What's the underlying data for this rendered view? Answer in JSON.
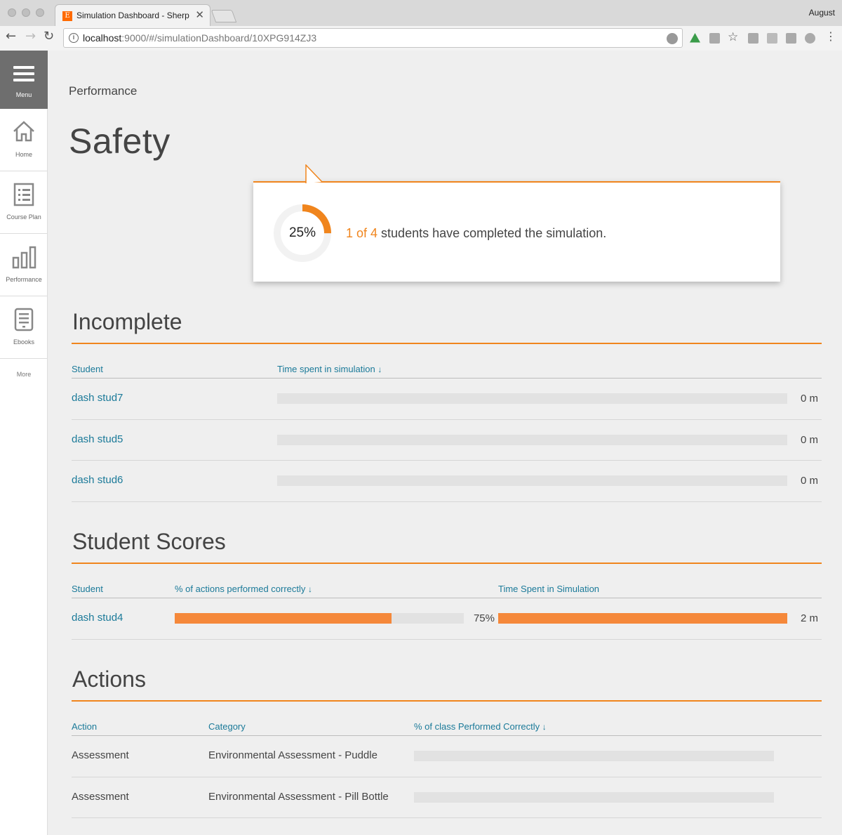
{
  "browser": {
    "tab_title": "Simulation Dashboard - Sherp",
    "tab_close": "✕",
    "profile_name": "August",
    "url_host": "localhost",
    "url_rest": ":9000/#/simulationDashboard/10XPG914ZJ3",
    "favicon_letter": "E"
  },
  "nav": {
    "menu_label": "Menu",
    "items": [
      {
        "label": "Home",
        "icon": "home-icon"
      },
      {
        "label": "Course Plan",
        "icon": "course-plan-icon"
      },
      {
        "label": "Performance",
        "icon": "bar-chart-icon"
      },
      {
        "label": "Ebooks",
        "icon": "ebook-icon"
      }
    ],
    "more_label": "More"
  },
  "page": {
    "breadcrumb": "Performance",
    "title": "Safety"
  },
  "completion": {
    "percent_label": "25%",
    "percent": 25,
    "count_text": "1 of 4",
    "rest_text": " students have completed the simulation."
  },
  "incomplete": {
    "title": "Incomplete",
    "col_student": "Student",
    "col_time": "Time spent in simulation",
    "sort_icon": "↓",
    "rows": [
      {
        "student": "dash stud7",
        "time": "0 m",
        "progress": 0
      },
      {
        "student": "dash stud5",
        "time": "0 m",
        "progress": 0
      },
      {
        "student": "dash stud6",
        "time": "0 m",
        "progress": 0
      }
    ]
  },
  "scores": {
    "title": "Student Scores",
    "col_student": "Student",
    "col_pct": "% of actions performed correctly",
    "col_time": "Time Spent in Simulation",
    "sort_icon": "↓",
    "rows": [
      {
        "student": "dash stud4",
        "pct_label": "75%",
        "pct": 0.75,
        "time": "2 m",
        "time_fraction": 1.0
      }
    ]
  },
  "actions": {
    "title": "Actions",
    "col_action": "Action",
    "col_category": "Category",
    "col_pct": "% of class Performed Correctly",
    "sort_icon": "↓",
    "rows": [
      {
        "action": "Assessment",
        "category": "Environmental Assessment - Puddle",
        "pct": 0
      },
      {
        "action": "Assessment",
        "category": "Environmental Assessment - Pill Bottle",
        "pct": 0
      }
    ]
  },
  "colors": {
    "accent": "#f0851d",
    "link": "#1b7a99",
    "bar_fill": "#f5883a",
    "bar_track": "#e2e2e2"
  }
}
